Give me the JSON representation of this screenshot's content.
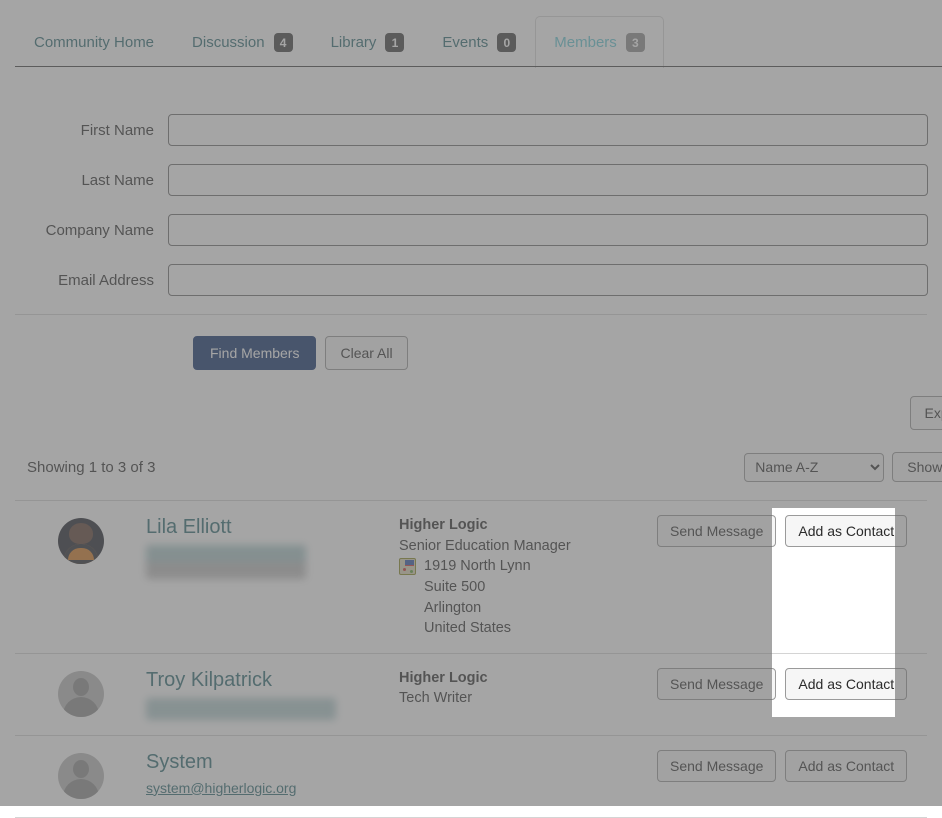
{
  "tabs": [
    {
      "label": "Community Home",
      "badge": null,
      "active": false,
      "name": "tab-community-home"
    },
    {
      "label": "Discussion",
      "badge": "4",
      "active": false,
      "name": "tab-discussion"
    },
    {
      "label": "Library",
      "badge": "1",
      "active": false,
      "name": "tab-library"
    },
    {
      "label": "Events",
      "badge": "0",
      "active": false,
      "name": "tab-events"
    },
    {
      "label": "Members",
      "badge": "3",
      "active": true,
      "name": "tab-members"
    }
  ],
  "search_form": {
    "fields": [
      {
        "label": "First Name",
        "value": "",
        "placeholder": ""
      },
      {
        "label": "Last Name",
        "value": "",
        "placeholder": ""
      },
      {
        "label": "Company Name",
        "value": "",
        "placeholder": ""
      },
      {
        "label": "Email Address",
        "value": "",
        "placeholder": ""
      }
    ],
    "find_label": "Find Members",
    "clear_label": "Clear All"
  },
  "export_label": "Export",
  "results": {
    "showing_text": "Showing 1 to 3 of 3",
    "sort_value": "Name A-Z",
    "sort_options": [
      "Name A-Z"
    ],
    "show_all_label": "Show All"
  },
  "actions": {
    "send_message_label": "Send Message",
    "add_as_contact_label": "Add as Contact"
  },
  "members": [
    {
      "name": "Lila Elliott",
      "email": "",
      "email_redacted": true,
      "avatar": "photo",
      "company": "Higher Logic",
      "title": "Senior Education Manager",
      "address": [
        "1919 North Lynn",
        "Suite 500",
        "Arlington",
        "United States"
      ],
      "map_icon": "map-pin-icon"
    },
    {
      "name": "Troy Kilpatrick",
      "email": "",
      "email_redacted": true,
      "avatar": "silhouette",
      "company": "Higher Logic",
      "title": "Tech Writer",
      "address": [],
      "map_icon": null
    },
    {
      "name": "System",
      "email": "system@higherlogic.org",
      "email_redacted": false,
      "avatar": "silhouette",
      "company": "",
      "title": "",
      "address": [],
      "map_icon": null
    }
  ],
  "colors": {
    "tab_active_text": "#62c7d4",
    "tab_text": "#2b6a72",
    "primary_button": "#0d2d6b",
    "link": "#2b6a72",
    "overlay": "rgba(110,110,110,0.62)"
  }
}
